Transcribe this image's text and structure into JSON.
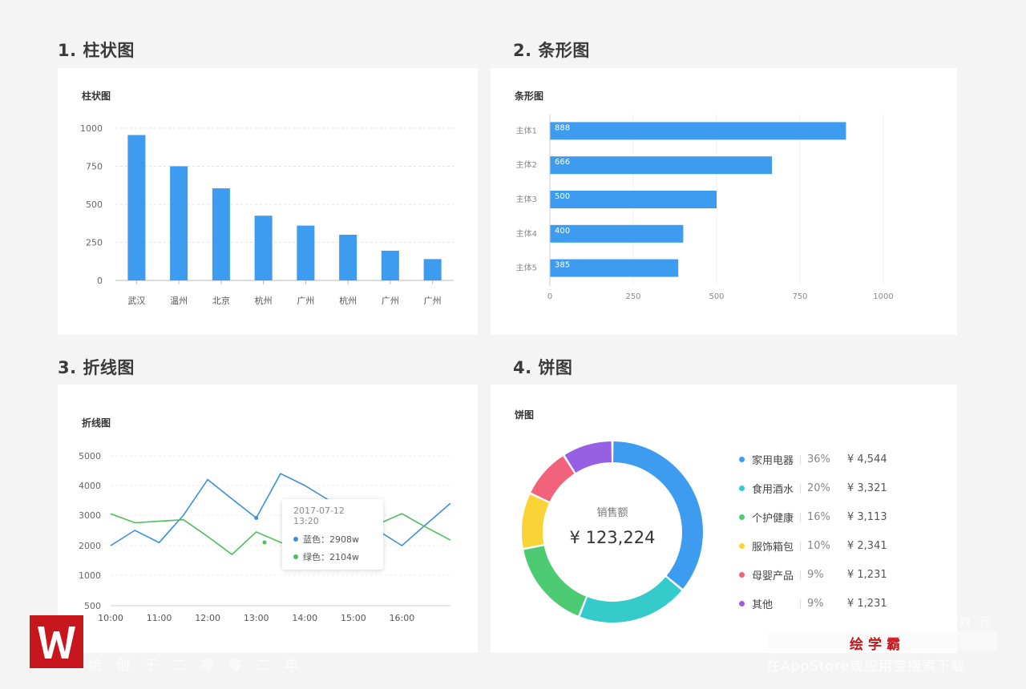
{
  "sections": {
    "bar": "1. 柱状图",
    "hbar": "2. 条形图",
    "line": "3. 折线图",
    "pie": "4. 饼图"
  },
  "cards": {
    "bar_title": "柱状图",
    "hbar_title": "条形图",
    "line_title": "折线图",
    "pie_title": "饼图"
  },
  "chart_data": [
    {
      "type": "bar",
      "title": "柱状图",
      "categories": [
        "武汉",
        "温州",
        "北京",
        "杭州",
        "广州",
        "杭州",
        "广州",
        "广州"
      ],
      "values": [
        955,
        750,
        605,
        425,
        360,
        300,
        195,
        140
      ],
      "ylim": [
        0,
        1000
      ],
      "yticks": [
        0,
        250,
        500,
        750,
        1000
      ],
      "grid": true,
      "color": "#3d9cf0"
    },
    {
      "type": "bar",
      "orientation": "horizontal",
      "title": "条形图",
      "categories": [
        "主体1",
        "主体2",
        "主体3",
        "主体4",
        "主体5"
      ],
      "values": [
        888,
        666,
        500,
        400,
        385
      ],
      "xlim": [
        0,
        1000
      ],
      "xticks": [
        0,
        250,
        500,
        750,
        1000
      ],
      "grid": true,
      "color": "#3d9cf0"
    },
    {
      "type": "line",
      "title": "折线图",
      "x": [
        "10:00",
        "10:30",
        "11:00",
        "11:30",
        "12:00",
        "12:30",
        "13:00",
        "13:30",
        "14:00",
        "14:30",
        "15:00",
        "15:30",
        "16:00",
        "16:30",
        "17:00"
      ],
      "xticks": [
        "10:00",
        "11:00",
        "12:00",
        "13:00",
        "14:00",
        "15:00",
        "16:00"
      ],
      "ylim": [
        500,
        5000
      ],
      "yticks": [
        500,
        1000,
        2000,
        3000,
        4000,
        5000
      ],
      "grid": true,
      "series": [
        {
          "name": "蓝色",
          "color": "#3d8fdc",
          "values": [
            2000,
            2500,
            2100,
            3000,
            4200,
            3550,
            2908,
            4400,
            4000,
            3500,
            2800,
            2500,
            2000,
            2700,
            3400
          ]
        },
        {
          "name": "绿色",
          "color": "#4cbf5a",
          "values": [
            3050,
            2750,
            2800,
            2850,
            2300,
            1700,
            2450,
            2104,
            1900,
            2000,
            2600,
            2700,
            3050,
            2600,
            2180
          ]
        }
      ],
      "tooltip": {
        "time": "2017-07-12  13:20",
        "rows": [
          {
            "label": "蓝色：",
            "value": "2908w",
            "color": "#3d8fdc"
          },
          {
            "label": "绿色：",
            "value": "2104w",
            "color": "#4cbf5a"
          }
        ]
      }
    },
    {
      "type": "pie",
      "title": "饼图",
      "center_label": "销售额",
      "center_value": "¥ 123,224",
      "slices": [
        {
          "name": "家用电器",
          "percent": "36%",
          "value": "¥ 4,544",
          "share": 0.36,
          "color": "#3d9cf0"
        },
        {
          "name": "食用酒水",
          "percent": "20%",
          "value": "¥ 3,321",
          "share": 0.2,
          "color": "#36cbcb"
        },
        {
          "name": "个护健康",
          "percent": "16%",
          "value": "¥ 3,113",
          "share": 0.16,
          "color": "#4dcb73"
        },
        {
          "name": "服饰箱包",
          "percent": "10%",
          "value": "¥ 2,341",
          "share": 0.1,
          "color": "#fad337"
        },
        {
          "name": "母婴产品",
          "percent": "9%",
          "value": "¥ 1,231",
          "share": 0.09,
          "color": "#f2637b"
        },
        {
          "name": "其他",
          "percent": "9%",
          "value": "¥ 1,231",
          "share": 0.09,
          "color": "#975fe4"
        }
      ]
    }
  ],
  "watermark": {
    "slogan": "始创于二零零二年",
    "brand": "绘学霸",
    "store": "在AppStore或应用宝搜索下载",
    "top": "教程"
  }
}
